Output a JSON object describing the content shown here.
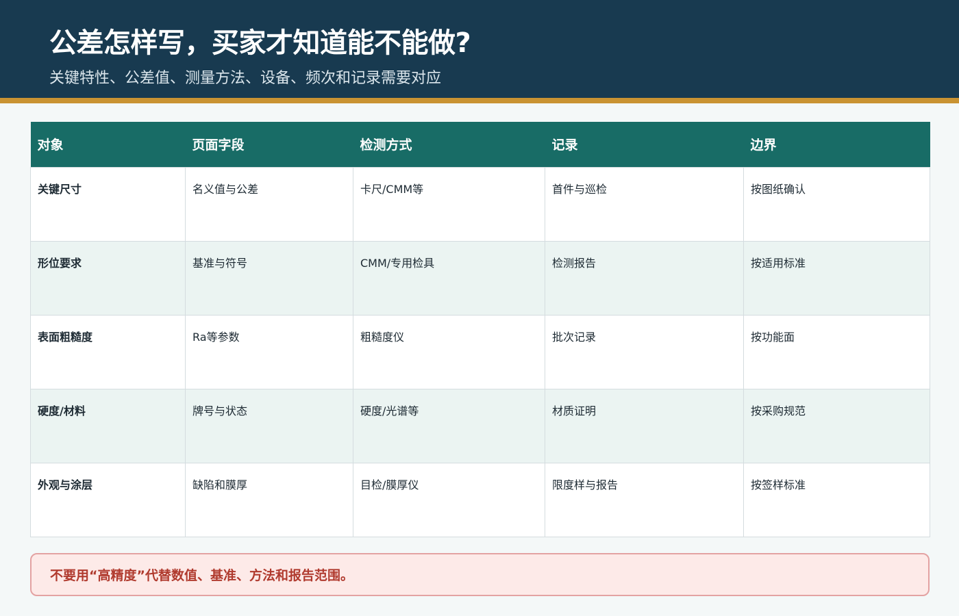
{
  "header": {
    "title": "公差怎样写，买家才知道能不能做?",
    "subtitle": "关键特性、公差值、测量方法、设备、频次和记录需要对应"
  },
  "table": {
    "columns": [
      "对象",
      "页面字段",
      "检测方式",
      "记录",
      "边界"
    ],
    "rows": [
      [
        "关键尺寸",
        "名义值与公差",
        "卡尺/CMM等",
        "首件与巡检",
        "按图纸确认"
      ],
      [
        "形位要求",
        "基准与符号",
        "CMM/专用检具",
        "检测报告",
        "按适用标准"
      ],
      [
        "表面粗糙度",
        "Ra等参数",
        "粗糙度仪",
        "批次记录",
        "按功能面"
      ],
      [
        "硬度/材料",
        "牌号与状态",
        "硬度/光谱等",
        "材质证明",
        "按采购规范"
      ],
      [
        "外观与涂层",
        "缺陷和膜厚",
        "目检/膜厚仪",
        "限度样与报告",
        "按签样标准"
      ]
    ]
  },
  "note": {
    "text": "不要用“高精度”代替数值、基准、方法和报告范围。"
  },
  "colors": {
    "header_bg": "#183a50",
    "accent_bar": "#c99332",
    "table_header_bg": "#186c66",
    "row_alt_bg": "#ebf4f2",
    "note_bg": "#fdeae8",
    "note_text": "#b03a2e"
  }
}
